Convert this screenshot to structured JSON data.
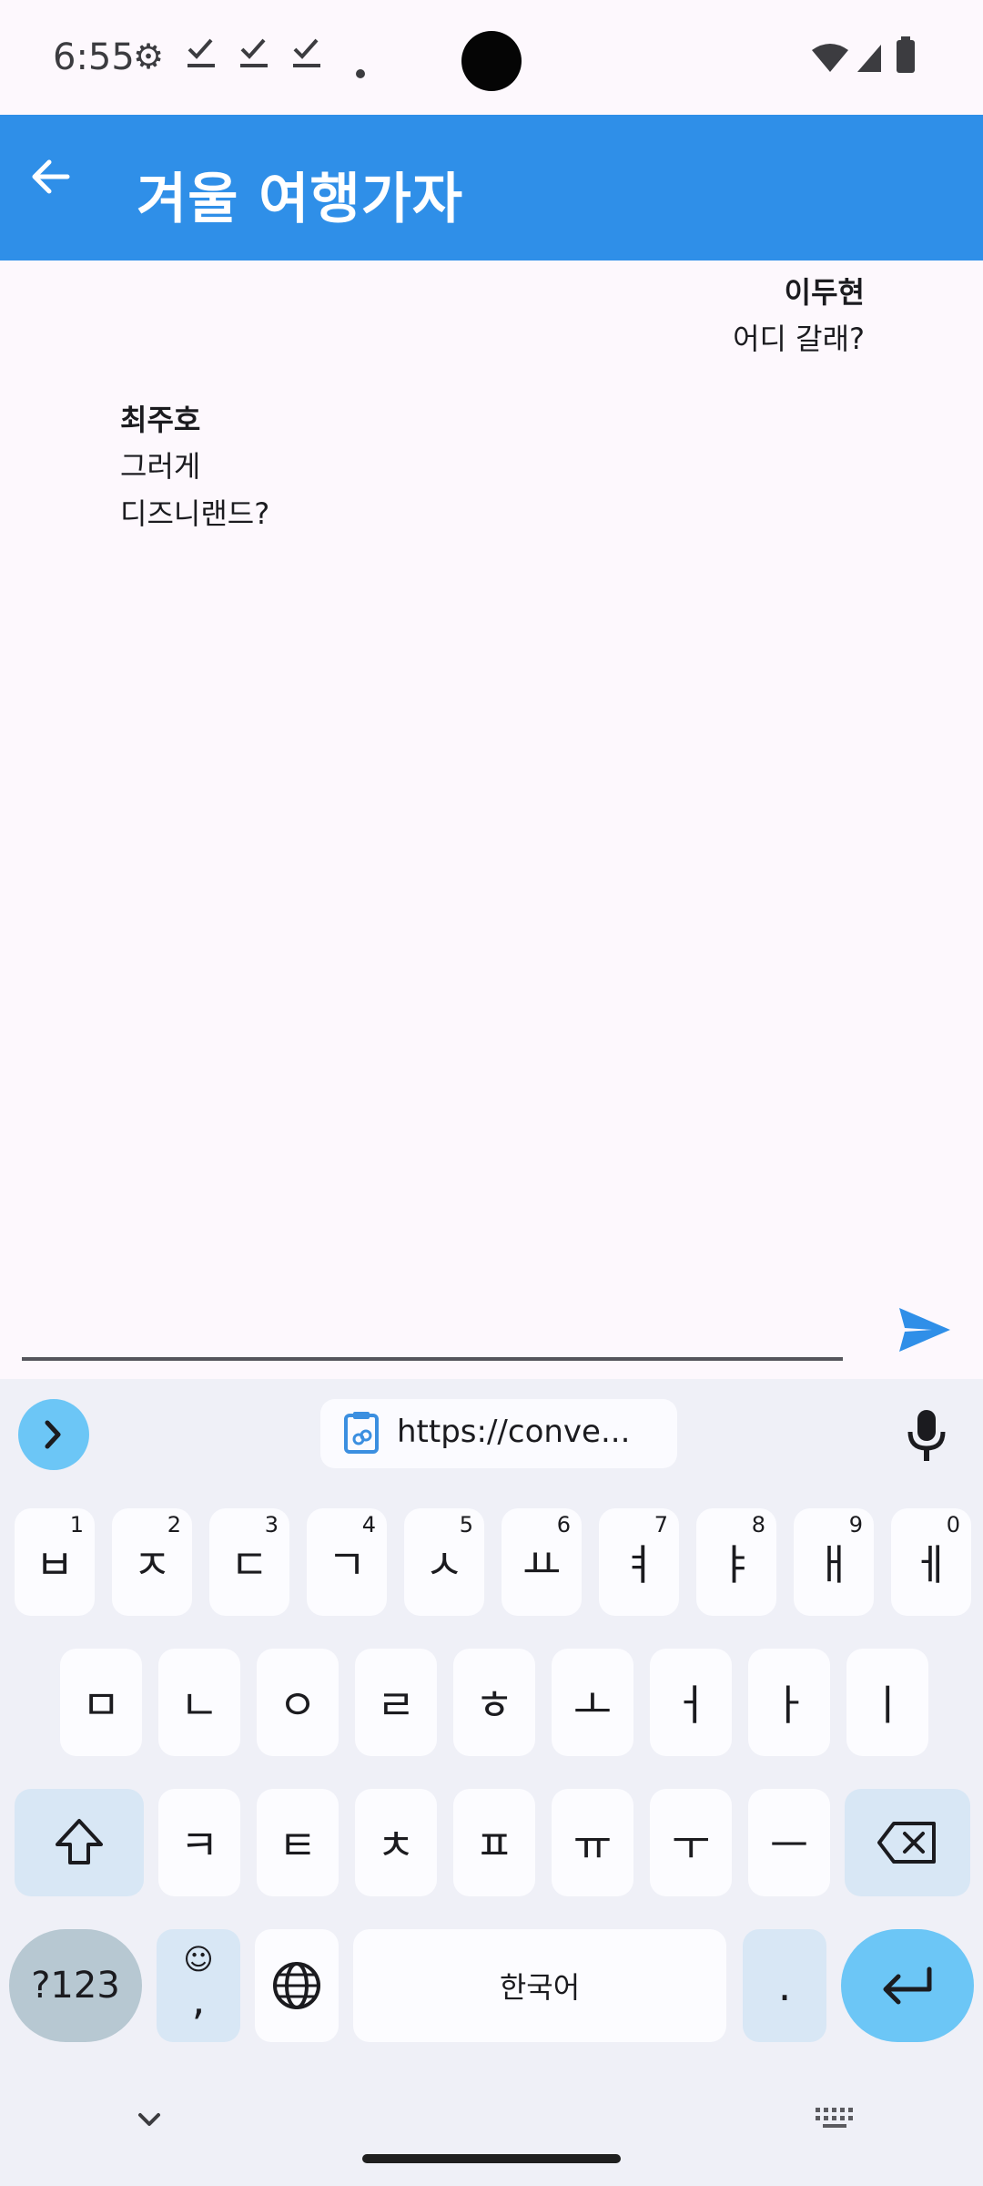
{
  "status_bar": {
    "time": "6:55"
  },
  "app_bar": {
    "title": "겨울 여행가자"
  },
  "messages": [
    {
      "sender": "이두현",
      "lines": [
        "어디 갈래?"
      ],
      "side": "right"
    },
    {
      "sender": "최주호",
      "lines": [
        "그러게",
        "디즈니랜드?"
      ],
      "side": "left"
    }
  ],
  "input": {
    "value": ""
  },
  "keyboard": {
    "clipboard_text": "https://conve...",
    "row1": [
      {
        "label": "ㅂ",
        "num": "1"
      },
      {
        "label": "ㅈ",
        "num": "2"
      },
      {
        "label": "ㄷ",
        "num": "3"
      },
      {
        "label": "ㄱ",
        "num": "4"
      },
      {
        "label": "ㅅ",
        "num": "5"
      },
      {
        "label": "ㅛ",
        "num": "6"
      },
      {
        "label": "ㅕ",
        "num": "7"
      },
      {
        "label": "ㅑ",
        "num": "8"
      },
      {
        "label": "ㅐ",
        "num": "9"
      },
      {
        "label": "ㅔ",
        "num": "0"
      }
    ],
    "row2": [
      "ㅁ",
      "ㄴ",
      "ㅇ",
      "ㄹ",
      "ㅎ",
      "ㅗ",
      "ㅓ",
      "ㅏ",
      "ㅣ"
    ],
    "row3": [
      "ㅋ",
      "ㅌ",
      "ㅊ",
      "ㅍ",
      "ㅠ",
      "ㅜ",
      "ㅡ"
    ],
    "symbols_label": "?123",
    "emoji_comma": ",",
    "space_label": "한국어",
    "period_label": "."
  },
  "colors": {
    "app_bar": "#2f8fe8",
    "accent": "#2f8fe8",
    "keyboard_accent": "#6cc6f6"
  }
}
